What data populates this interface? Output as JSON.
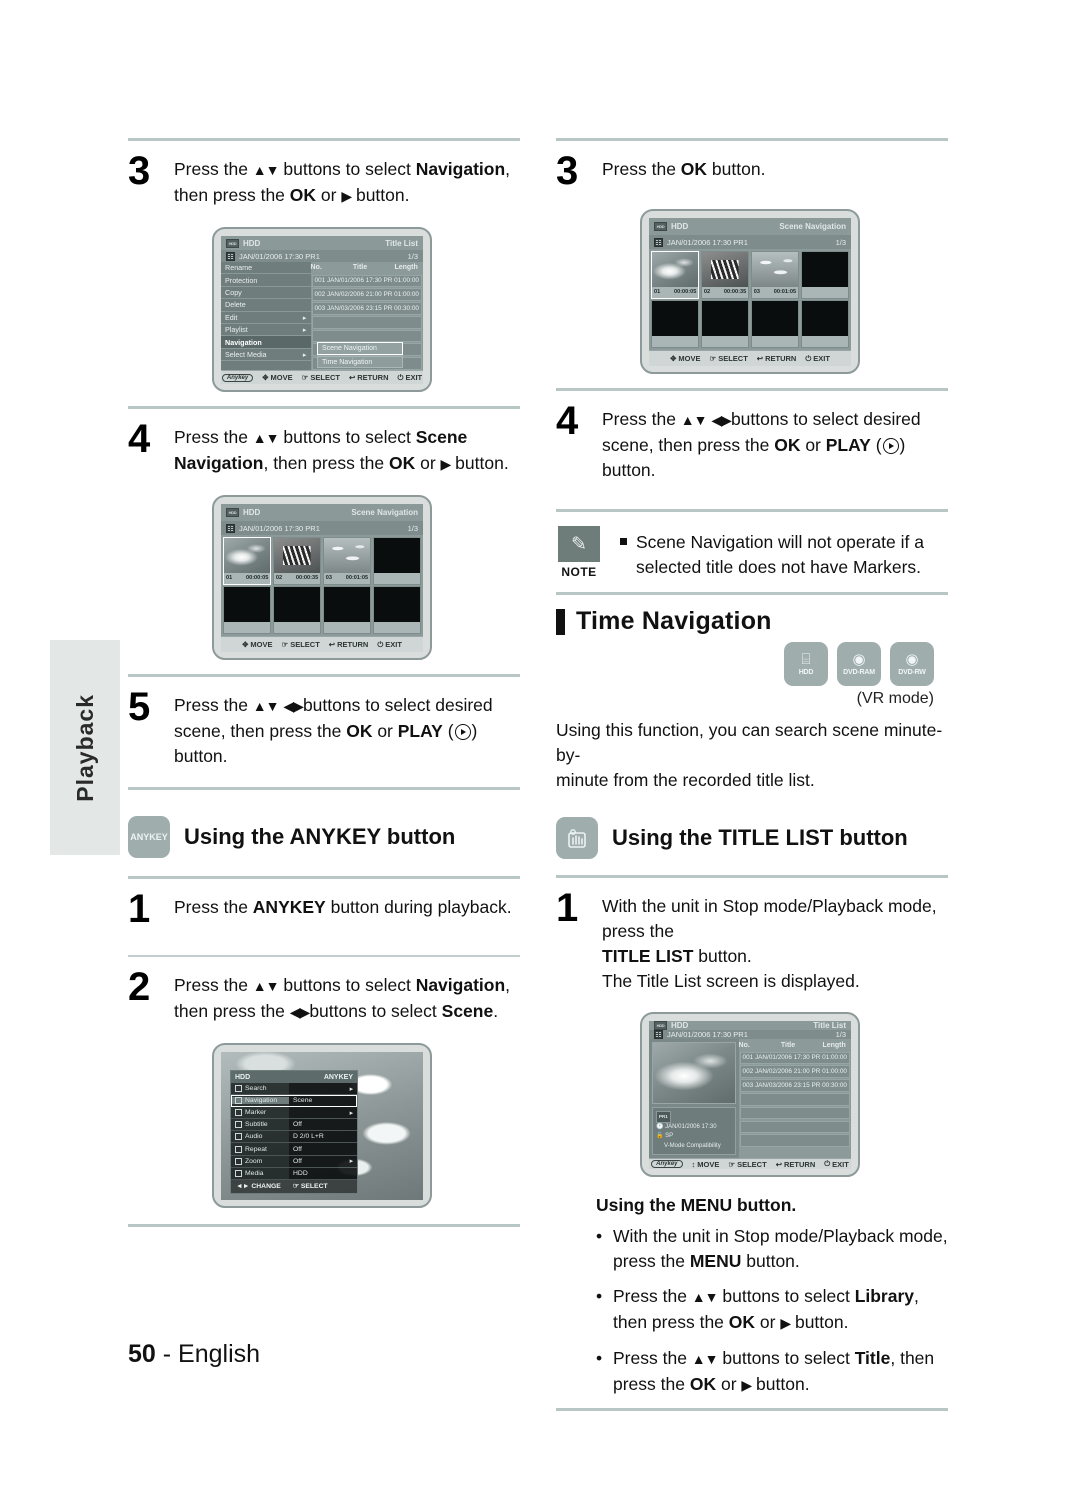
{
  "page": {
    "side_tab": "Playback",
    "footer_number": "50",
    "footer_sep": "-",
    "footer_lang": "English"
  },
  "left_column": {
    "step3": {
      "num": "3",
      "line1_a": "Press the ",
      "line1_arrows": "▲▼",
      "line1_b": " buttons to select ",
      "line1_bold": "Navigation",
      "line1_c": ",",
      "line2_a": "then press the ",
      "line2_bold": "OK",
      "line2_b": " or ",
      "line2_arrow": "▶",
      "line2_c": " button."
    },
    "screen_title_list": {
      "device": "HDD",
      "screen_name": "Title List",
      "sub_date": "JAN/01/2006 17:30 PR1",
      "page_indicator": "1/3",
      "menu_items": [
        {
          "label": "Rename",
          "arrow": "",
          "selected": false
        },
        {
          "label": "Protection",
          "arrow": "",
          "selected": false
        },
        {
          "label": "Copy",
          "arrow": "",
          "selected": false
        },
        {
          "label": "Delete",
          "arrow": "",
          "selected": false
        },
        {
          "label": "Edit",
          "arrow": "▸",
          "selected": false
        },
        {
          "label": "Playlist",
          "arrow": "▸",
          "selected": false
        },
        {
          "label": "Navigation",
          "arrow": "",
          "selected": true
        },
        {
          "label": "Select Media",
          "arrow": "▸",
          "selected": false
        }
      ],
      "list_headers": [
        "No.",
        "Title",
        "Length"
      ],
      "list_rows": [
        "001  JAN/01/2006 17:30 PR  01:00:00",
        "002  JAN/02/2006 21:00 PR  01:00:00",
        "003  JAN/03/2006 23:15 PR  00:30:00"
      ],
      "submenu": [
        {
          "label": "Scene Navigation",
          "highlighted": true
        },
        {
          "label": "Time Navigation",
          "highlighted": false
        }
      ],
      "bottom_bar": {
        "anykey": "Anykey",
        "move": "MOVE",
        "select": "SELECT",
        "return": "RETURN",
        "exit": "EXIT"
      }
    },
    "step4": {
      "num": "4",
      "line1_a": "Press the ",
      "line1_arrows": "▲▼",
      "line1_b": " buttons to select ",
      "line1_bold": "Scene",
      "line2_bold": "Navigation",
      "line2_a": ", then press the ",
      "line2_bold2": "OK",
      "line2_b": " or ",
      "line2_arrow": "▶",
      "line2_c": " button."
    },
    "screen_scene_nav": {
      "device": "HDD",
      "screen_name": "Scene Navigation",
      "sub_date": "JAN/01/2006 17:30 PR1",
      "page_indicator": "1/3",
      "scenes": [
        {
          "index": "01",
          "time": "00:00:05",
          "selected": true,
          "photo": "gull"
        },
        {
          "index": "02",
          "time": "00:00:35",
          "selected": false,
          "photo": "butterfly"
        },
        {
          "index": "03",
          "time": "00:01:05",
          "selected": false,
          "photo": "birds"
        },
        {
          "index": "",
          "time": "",
          "selected": false,
          "photo": ""
        },
        {
          "index": "",
          "time": "",
          "selected": false,
          "photo": ""
        },
        {
          "index": "",
          "time": "",
          "selected": false,
          "photo": ""
        },
        {
          "index": "",
          "time": "",
          "selected": false,
          "photo": ""
        },
        {
          "index": "",
          "time": "",
          "selected": false,
          "photo": ""
        }
      ],
      "bottom_bar": {
        "move": "MOVE",
        "select": "SELECT",
        "return": "RETURN",
        "exit": "EXIT"
      }
    },
    "step5": {
      "num": "5",
      "line1_a": "Press the ",
      "line1_arrows1": "▲▼",
      "line1_arrows2": "◀▶",
      "line1_b": "buttons to select desired",
      "line2_a": "scene, then press the ",
      "line2_bold1": "OK",
      "line2_b": " or ",
      "line2_bold2": "PLAY",
      "line2_c": " (",
      "line2_d": ") button."
    },
    "anykey_section": {
      "icon_label": "ANYKEY",
      "heading": "Using the ANYKEY button",
      "step1": {
        "num": "1",
        "a": "Press the ",
        "bold": "ANYKEY",
        "b": " button during playback."
      },
      "step2": {
        "num": "2",
        "line1_a": "Press the ",
        "line1_arrows": "▲▼",
        "line1_b": " buttons to select ",
        "line1_bold": "Navigation",
        "line1_c": ",",
        "line2_a": "then press the ",
        "line2_arrows": "◀▶",
        "line2_b": "buttons to select ",
        "line2_bold": "Scene",
        "line2_c": "."
      }
    },
    "screen_anykey": {
      "device": "HDD",
      "screen_name": "ANYKEY",
      "rows": [
        {
          "key": "Search",
          "value": "",
          "arrow": "▸",
          "selected": false
        },
        {
          "key": "Navigation",
          "value": "Scene",
          "arrow": "",
          "selected": true
        },
        {
          "key": "Marker",
          "value": "",
          "arrow": "▸",
          "selected": false
        },
        {
          "key": "Subtitle",
          "value": "Off",
          "arrow": "",
          "selected": false
        },
        {
          "key": "Audio",
          "value": "D 2/0 L+R",
          "arrow": "",
          "selected": false
        },
        {
          "key": "Repeat",
          "value": "Off",
          "arrow": "",
          "selected": false
        },
        {
          "key": "Zoom",
          "value": "Off",
          "arrow": "▸",
          "selected": false
        },
        {
          "key": "Media",
          "value": "HDD",
          "arrow": "",
          "selected": false
        }
      ],
      "bottom_bar": {
        "change": "CHANGE",
        "select": "SELECT"
      }
    }
  },
  "right_column": {
    "step3": {
      "num": "3",
      "a": "Press the ",
      "bold": "OK",
      "b": " button."
    },
    "screen_scene_nav": {
      "device": "HDD",
      "screen_name": "Scene Navigation",
      "sub_date": "JAN/01/2006 17:30 PR1",
      "page_indicator": "1/3",
      "scenes": [
        {
          "index": "01",
          "time": "00:00:05",
          "selected": true,
          "photo": "gull"
        },
        {
          "index": "02",
          "time": "00:00:35",
          "selected": false,
          "photo": "butterfly"
        },
        {
          "index": "03",
          "time": "00:01:05",
          "selected": false,
          "photo": "birds"
        },
        {
          "index": "",
          "time": "",
          "selected": false,
          "photo": ""
        },
        {
          "index": "",
          "time": "",
          "selected": false,
          "photo": ""
        },
        {
          "index": "",
          "time": "",
          "selected": false,
          "photo": ""
        },
        {
          "index": "",
          "time": "",
          "selected": false,
          "photo": ""
        },
        {
          "index": "",
          "time": "",
          "selected": false,
          "photo": ""
        }
      ],
      "bottom_bar": {
        "move": "MOVE",
        "select": "SELECT",
        "return": "RETURN",
        "exit": "EXIT"
      }
    },
    "step4": {
      "num": "4",
      "line1_a": "Press the ",
      "line1_arrows1": "▲▼",
      "line1_arrows2": "◀▶",
      "line1_b": "buttons to select desired",
      "line2_a": "scene, then press the ",
      "line2_bold1": "OK",
      "line2_b": " or ",
      "line2_bold2": "PLAY",
      "line2_c": " (",
      "line2_d": ") button."
    },
    "note": {
      "caption": "NOTE",
      "line1": "Scene Navigation will not operate if a",
      "line2": "selected title does not have Markers."
    },
    "time_navigation": {
      "heading": "Time Navigation",
      "media_badges": [
        {
          "cap": "HDD",
          "glyph": "⌸"
        },
        {
          "cap": "DVD-RAM",
          "glyph": "◉"
        },
        {
          "cap": "DVD-RW",
          "glyph": "◉"
        }
      ],
      "vr_mode": "(VR mode)",
      "paragraph_line1": "Using this function, you can search scene minute-by-",
      "paragraph_line2": "minute from the recorded title list."
    },
    "title_list_section": {
      "icon_label": "hand-press-icon",
      "heading": "Using the TITLE LIST button",
      "step1": {
        "num": "1",
        "line1": "With the unit in Stop mode/Playback mode, press the",
        "line2_bold": "TITLE LIST",
        "line2_rest": " button.",
        "line3": "The Title List screen is displayed."
      }
    },
    "screen_title_list": {
      "device": "HDD",
      "screen_name": "Title List",
      "sub_date": "JAN/01/2006 17:30 PR1",
      "page_indicator": "1/3",
      "preview_info": {
        "badge": "PR1",
        "datetime": "JAN/01/2006 17:30",
        "mode": "SP",
        "compat": "V-Mode Compatibility"
      },
      "list_headers": [
        "No.",
        "Title",
        "Length"
      ],
      "list_rows": [
        "001  JAN/01/2006 17:30 PR  01:00:00",
        "002  JAN/02/2006 21:00 PR  01:00:00",
        "003  JAN/03/2006 23:15 PR  00:30:00"
      ],
      "bottom_bar": {
        "anykey": "Anykey",
        "move": "MOVE",
        "select": "SELECT",
        "return": "RETURN",
        "exit": "EXIT"
      }
    },
    "menu_button_section": {
      "heading": "Using the MENU button.",
      "bullets": [
        {
          "l1_a": "With the unit in Stop mode/Playback mode,",
          "l2_a": "press the ",
          "l2_bold": "MENU",
          "l2_b": " button."
        },
        {
          "l1_a": "Press the ",
          "l1_arrows": "▲▼",
          "l1_b": " buttons to select ",
          "l1_bold": "Library",
          "l1_c": ",",
          "l2_a": "then press the ",
          "l2_bold": "OK",
          "l2_b": " or ",
          "l2_arrow": "▶",
          "l2_c": " button."
        },
        {
          "l1_a": "Press the ",
          "l1_arrows": "▲▼",
          "l1_b": " buttons to select ",
          "l1_bold": "Title",
          "l1_c": ", then",
          "l2_a": "press the ",
          "l2_bold": "OK",
          "l2_b": " or  ",
          "l2_arrow": "▶",
          "l2_c": " button."
        }
      ]
    }
  }
}
